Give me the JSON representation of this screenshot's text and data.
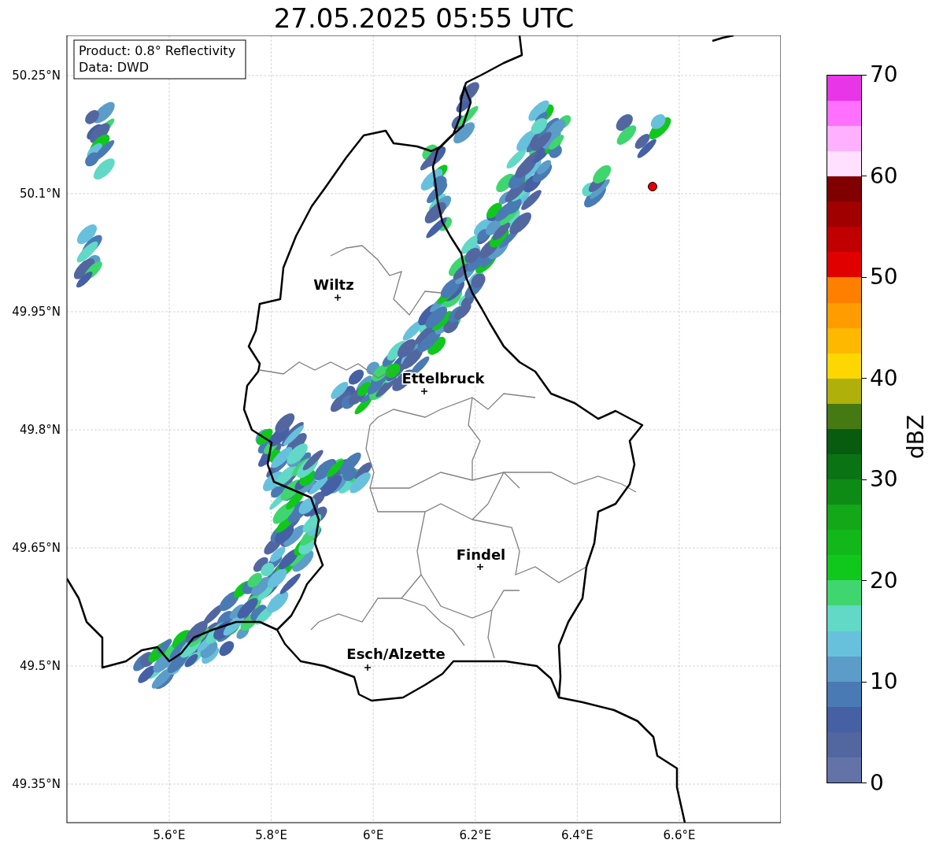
{
  "title": "27.05.2025 05:55 UTC",
  "info_box": [
    "Product: 0.8° Reflectivity",
    "Data: DWD"
  ],
  "map": {
    "lat_ticks": [
      "50.25°N",
      "50.1°N",
      "49.95°N",
      "49.8°N",
      "49.65°N",
      "49.5°N",
      "49.35°N"
    ],
    "lon_ticks": [
      "5.6°E",
      "5.8°E",
      "6°E",
      "6.2°E",
      "6.4°E",
      "6.6°E"
    ],
    "cities": [
      {
        "name": "Wiltz"
      },
      {
        "name": "Ettelbruck"
      },
      {
        "name": "Findel"
      },
      {
        "name": "Esch/Alzette"
      }
    ]
  },
  "colorbar": {
    "label": "dBZ",
    "ticks": [
      "70",
      "60",
      "50",
      "40",
      "30",
      "20",
      "10",
      "0"
    ],
    "bins": [
      {
        "color": "#6373a8"
      },
      {
        "color": "#5267a0"
      },
      {
        "color": "#4560a4"
      },
      {
        "color": "#4a7ab4"
      },
      {
        "color": "#5b9dc8"
      },
      {
        "color": "#67c1dd"
      },
      {
        "color": "#62d8c6"
      },
      {
        "color": "#3fd66f"
      },
      {
        "color": "#10c81c"
      },
      {
        "color": "#12b81a"
      },
      {
        "color": "#12a818"
      },
      {
        "color": "#0e8b15"
      },
      {
        "color": "#0a7414"
      },
      {
        "color": "#075c10"
      },
      {
        "color": "#457a12"
      },
      {
        "color": "#b0b00a"
      },
      {
        "color": "#ffd700"
      },
      {
        "color": "#ffb800"
      },
      {
        "color": "#ff9c00"
      },
      {
        "color": "#ff8000"
      },
      {
        "color": "#e00000"
      },
      {
        "color": "#c00000"
      },
      {
        "color": "#a00000"
      },
      {
        "color": "#800000"
      },
      {
        "color": "#ffe0ff"
      },
      {
        "color": "#ffb0ff"
      },
      {
        "color": "#ff70ff"
      },
      {
        "color": "#e835e8"
      }
    ]
  }
}
